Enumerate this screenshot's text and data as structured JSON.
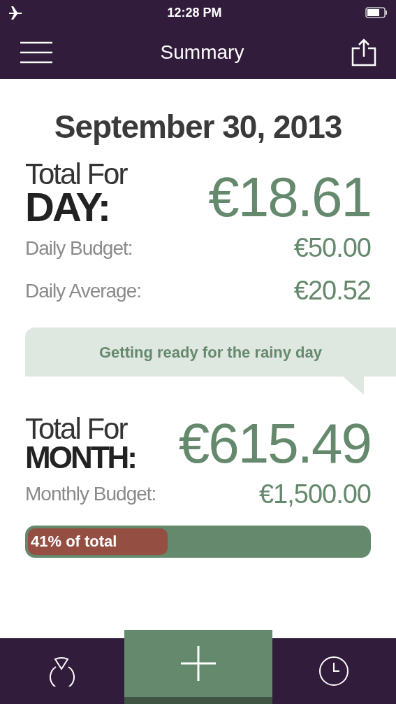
{
  "status_bar": {
    "time": "12:28 PM"
  },
  "nav": {
    "title": "Summary"
  },
  "date": "September 30, 2013",
  "day": {
    "label_top": "Total For",
    "label_big": "DAY:",
    "total": "€18.61",
    "rows": [
      {
        "label": "Daily Budget:",
        "value": "€50.00"
      },
      {
        "label": "Daily Average:",
        "value": "€20.52"
      }
    ]
  },
  "message": "Getting ready for the rainy day",
  "month": {
    "label_top": "Total For",
    "label_big": "MONTH:",
    "total": "€615.49",
    "rows": [
      {
        "label": "Monthly Budget:",
        "value": "€1,500.00"
      }
    ]
  },
  "progress": {
    "label": "41% of total",
    "level": 0.41
  },
  "tab_bar": [
    {
      "kind": "chart",
      "selected": false
    },
    {
      "kind": "add",
      "selected": true
    },
    {
      "kind": "history",
      "selected": false
    }
  ]
}
